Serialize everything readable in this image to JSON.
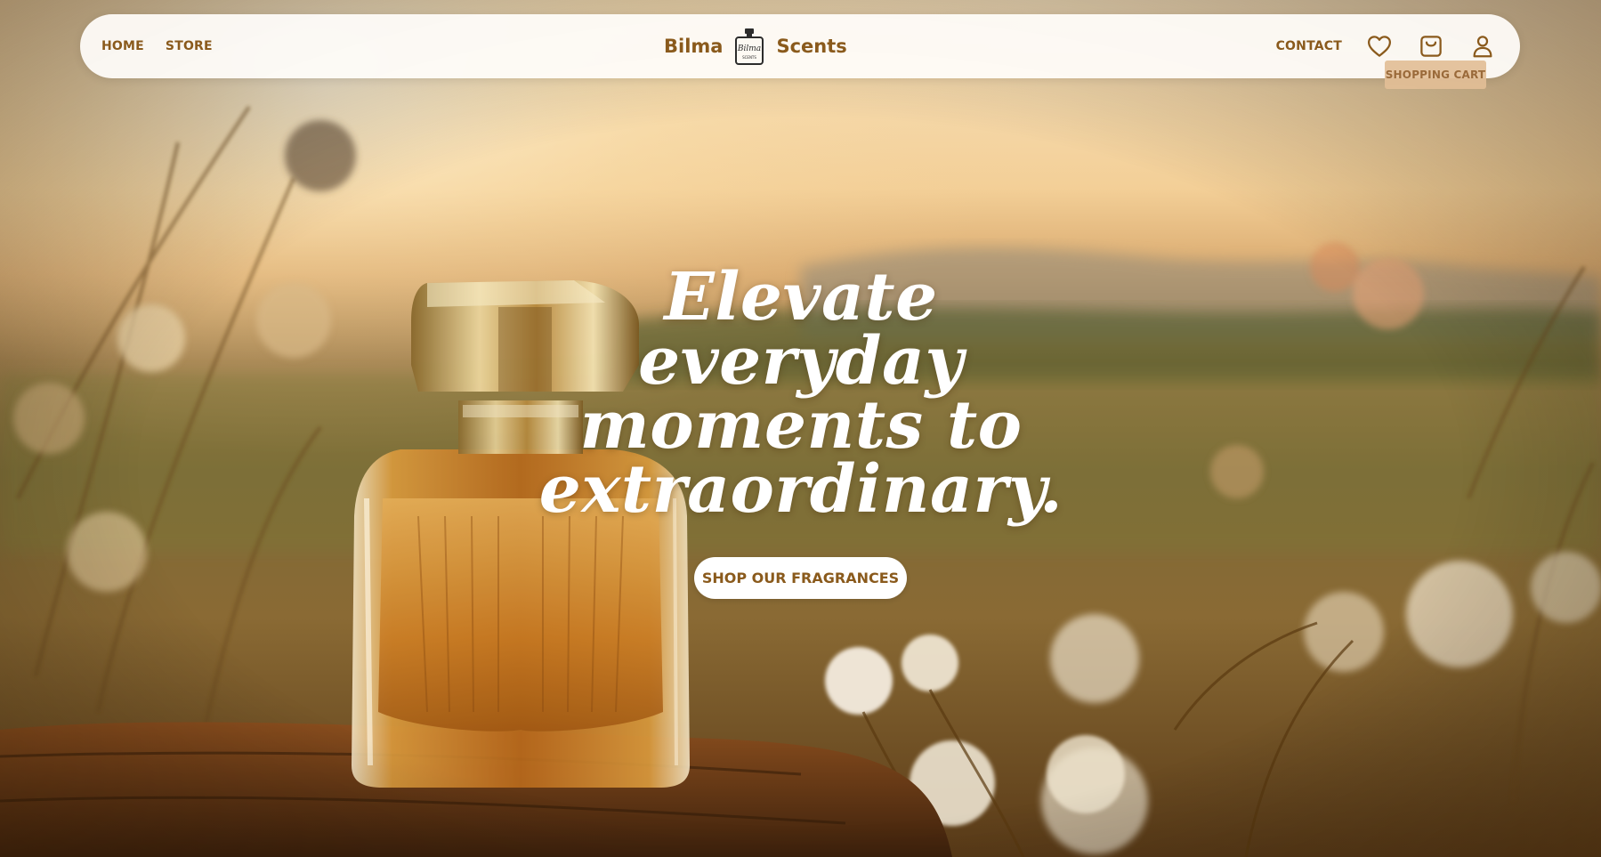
{
  "nav": {
    "links": [
      {
        "label": "HOME"
      },
      {
        "label": "STORE"
      }
    ],
    "brand": {
      "left_word": "Bilma",
      "right_word": "Scents",
      "logo_text": "Bilma",
      "logo_subtext": "SCENTS"
    },
    "contact_label": "CONTACT",
    "icons": {
      "wishlist": "heart-icon",
      "cart": "shopping-bag-icon",
      "account": "user-icon"
    }
  },
  "tooltip": {
    "text": "SHOPPING CART"
  },
  "hero": {
    "title": "Elevate everyday moments to extraordinary.",
    "cta_label": "SHOP OUR FRAGRANCES"
  },
  "colors": {
    "brand": "#8a5a1c",
    "tooltip_bg": "#e2be96",
    "sky": "#f3c98c"
  }
}
